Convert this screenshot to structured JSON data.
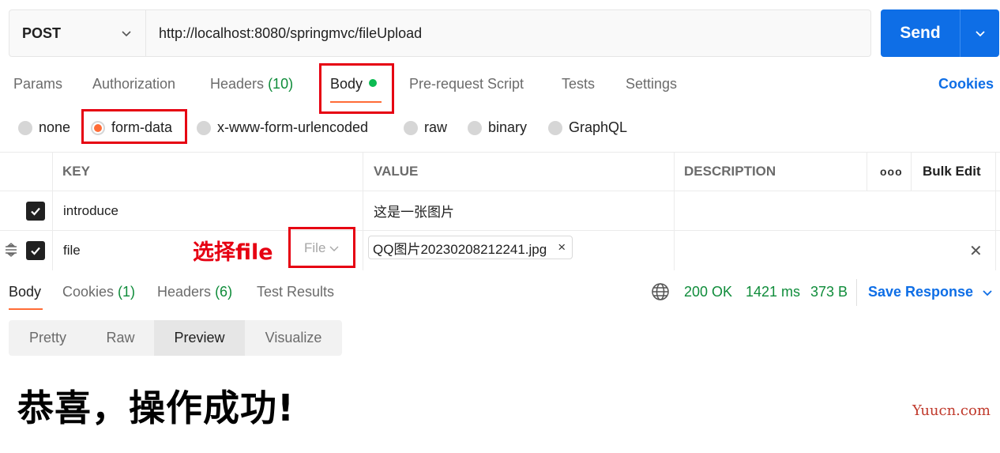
{
  "request": {
    "method": "POST",
    "url": "http://localhost:8080/springmvc/fileUpload",
    "send_label": "Send"
  },
  "tabs": {
    "params": "Params",
    "authorization": "Authorization",
    "headers": "Headers",
    "headers_count": "(10)",
    "body": "Body",
    "prerequest": "Pre-request Script",
    "tests": "Tests",
    "settings": "Settings",
    "cookies": "Cookies"
  },
  "body_types": {
    "none": "none",
    "form_data": "form-data",
    "urlencoded": "x-www-form-urlencoded",
    "raw": "raw",
    "binary": "binary",
    "graphql": "GraphQL",
    "selected": "form-data"
  },
  "table": {
    "headers": {
      "key": "KEY",
      "value": "VALUE",
      "description": "DESCRIPTION",
      "bulk_edit": "Bulk Edit",
      "more": "ooo"
    },
    "rows": [
      {
        "key": "introduce",
        "value": "这是一张图片",
        "checked": true
      },
      {
        "key": "file",
        "type": "File",
        "value": "QQ图片20230208212241.jpg",
        "remove": "×",
        "checked": true
      }
    ],
    "annotation": "选择file"
  },
  "response": {
    "tabs": {
      "body": "Body",
      "cookies": "Cookies",
      "cookies_count": "(1)",
      "headers": "Headers",
      "headers_count": "(6)",
      "test_results": "Test Results"
    },
    "status": "200 OK",
    "time": "1421 ms",
    "size": "373 B",
    "save": "Save Response",
    "views": {
      "pretty": "Pretty",
      "raw": "Raw",
      "preview": "Preview",
      "visualize": "Visualize",
      "selected": "Preview"
    },
    "preview_text": "恭喜，操作成功!"
  },
  "watermark": "Yuucn.com",
  "colors": {
    "accent": "#0e6ee6",
    "tab_active": "#ff6c37",
    "success": "#0f8c3a",
    "annotation": "#e60012"
  }
}
